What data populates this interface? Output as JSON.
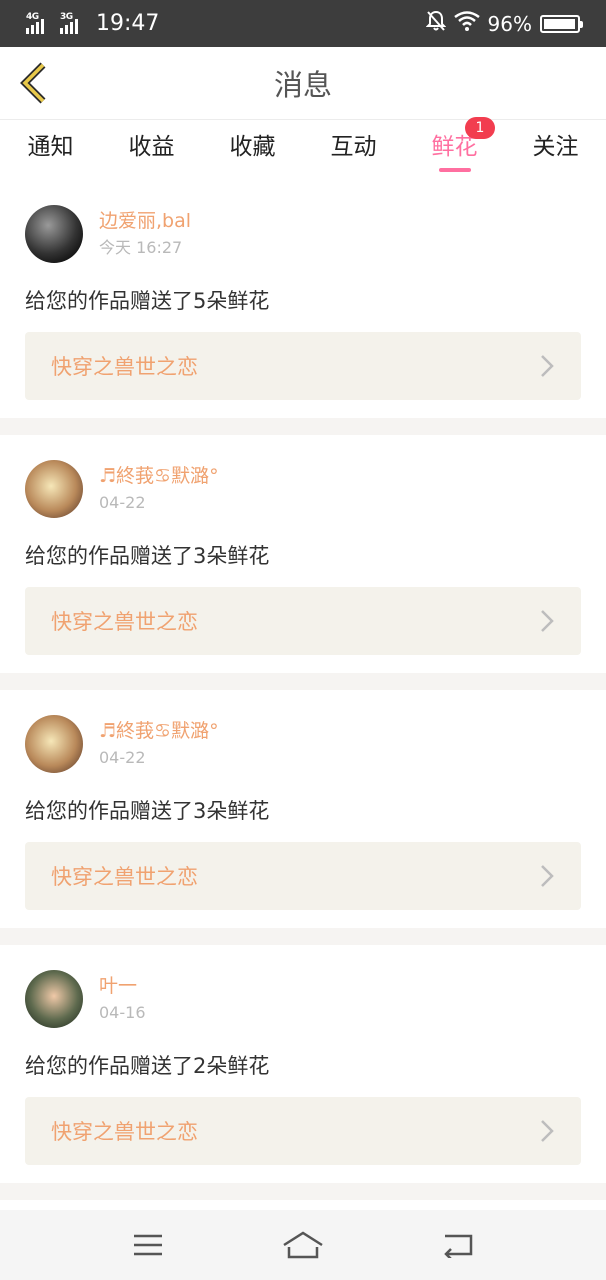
{
  "status_bar": {
    "network_1": "4G",
    "network_2": "3G",
    "time": "19:47",
    "battery": "96%",
    "battery_level": 0.96
  },
  "header": {
    "title": "消息"
  },
  "tabs": [
    {
      "label": "通知"
    },
    {
      "label": "收益"
    },
    {
      "label": "收藏"
    },
    {
      "label": "互动"
    },
    {
      "label": "鲜花",
      "badge": "1"
    },
    {
      "label": "关注"
    }
  ],
  "accent": {
    "pink": "#ff6fa0",
    "orange": "#f0a270",
    "badge_red": "#f23d4f"
  },
  "messages": [
    {
      "user": "边爱丽,bal",
      "time": "今天 16:27",
      "text": "给您的作品赠送了5朵鲜花",
      "work": "快穿之兽世之恋"
    },
    {
      "user": "♬終莪♋默潞°",
      "time": "04-22",
      "text": "给您的作品赠送了3朵鲜花",
      "work": "快穿之兽世之恋"
    },
    {
      "user": "♬終莪♋默潞°",
      "time": "04-22",
      "text": "给您的作品赠送了3朵鲜花",
      "work": "快穿之兽世之恋"
    },
    {
      "user": "叶一",
      "time": "04-16",
      "text": "给您的作品赠送了2朵鲜花",
      "work": "快穿之兽世之恋"
    }
  ],
  "nav": {
    "menu_icon": "menu-icon",
    "home_icon": "home-icon",
    "back_icon": "back-icon"
  }
}
